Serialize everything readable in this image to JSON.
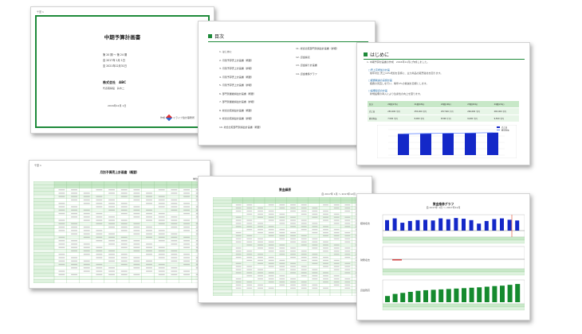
{
  "cover": {
    "corner": "千葉 1",
    "title": "中期予算計画書",
    "period_lines": [
      "第 20 期 ～ 第 24 期",
      "自 2017年 1月 1日",
      "至 2021年12月31日"
    ],
    "company": "株式会社　ABC",
    "representative": "代表取締役　鈴木二",
    "date": "2016年12月 1日",
    "logo_prefix": "作成",
    "logo_text": "ミライブ会計事務所"
  },
  "toc": {
    "title": "目次",
    "left_items": [
      "1. はじめに",
      "2. 月別予算売上計画書（概要）",
      "3. 月別予算売上計画書（詳細）",
      "4. 月別予算売上計画書（概要）",
      "5. 月別予算売上計画書（詳細）",
      "6. 部門別業績損益計画書（概要）",
      "7. 部門別業績損益計画書（詳細）",
      "8. 総合比較損益計画書（概要）",
      "9. 総合比較損益計画書（詳細）",
      "10. 総合比較部門別損益計画書（概要）"
    ],
    "right_items": [
      "11. 総合比較部門別損益計画書（詳細）",
      "12. 資金繰表",
      "13. 資金繰り計画書",
      "14. 資金推移グラフ"
    ]
  },
  "intro": {
    "title": "はじめに",
    "lead": "1. 中期予算計画書の作成　2016年11月に作成しました。",
    "sections": [
      {
        "heading": "□売上高増加の計画",
        "body": "前年対比 売上10%増加を目標に、主力商品の販売強化を図ります。"
      },
      {
        "heading": "□経費削減の実施計画",
        "body": "経費の見直しを行い、毎年2%の削減を目標とします。"
      },
      {
        "heading": "□設備投資の計画",
        "body": "新規設備の導入により生産性の向上を図ります。"
      }
    ],
    "table_headers": [
      "区分",
      "20期(17年)",
      "21期(18年)",
      "22期(19年)",
      "23期(20年)",
      "24期(21年)"
    ],
    "table_rows": [
      [
        "売上高",
        "250,000 千円",
        "255,000 千円",
        "257,500 千円",
        "260,000 千円",
        "265,000 千円"
      ],
      [
        "経常利益",
        "7,500 千円",
        "8,000 千円",
        "8,500 千円",
        "9,000 千円",
        "9,500 千円"
      ]
    ],
    "chart_legend": [
      "売上高",
      "経常利益"
    ],
    "chart_values": [
      250000,
      255000,
      257500,
      260000,
      265000
    ]
  },
  "sales_table": {
    "corner": "千葉 1",
    "title": "月別予算売上計画書（概要）",
    "unit": "単位:千円"
  },
  "cashflow": {
    "title": "資金繰表",
    "subtitle": "自 2017年 1月 ～ 2017年12月"
  },
  "graph": {
    "title": "資金推移グラフ",
    "subtitle": "自 2017年 1月 ～ 2017年12月",
    "row_labels": [
      "経常収支",
      "財務収支",
      "資金残高"
    ],
    "top_bars": [
      60,
      70,
      45,
      55,
      60,
      62,
      58,
      70,
      65,
      72,
      68,
      60,
      40,
      55,
      66,
      70,
      62,
      58
    ],
    "bottom_bars": [
      30,
      40,
      45,
      50,
      55,
      58,
      60,
      62,
      64,
      66,
      68,
      70,
      72,
      75,
      78,
      80,
      84,
      88
    ]
  },
  "colors": {
    "accent_green": "#1e8a3a",
    "table_green": "#c8e8c8",
    "bar_blue": "#1428c8",
    "bar_green": "#158a2e"
  }
}
